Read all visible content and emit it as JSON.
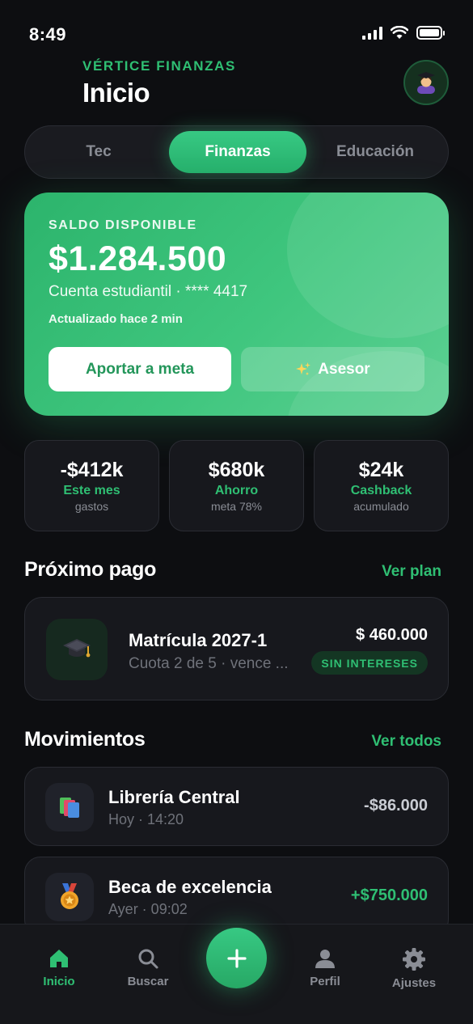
{
  "status_bar": {
    "time": "8:49"
  },
  "header": {
    "brand": "VÉRTICE FINANZAS",
    "title": "Inicio"
  },
  "tabs": [
    {
      "label": "Tec",
      "active": false
    },
    {
      "label": "Finanzas",
      "active": true
    },
    {
      "label": "Educación",
      "active": false
    }
  ],
  "balance": {
    "label": "SALDO DISPONIBLE",
    "amount": "$1.284.500",
    "account": "Cuenta estudiantil · **** 4417",
    "updated": "Actualizado hace 2 min",
    "primary_button": "Aportar a meta",
    "secondary_button": "Asesor"
  },
  "stats": [
    {
      "value": "-$412k",
      "label": "Este mes",
      "sub": "gastos"
    },
    {
      "value": "$680k",
      "label": "Ahorro",
      "sub": "meta 78%"
    },
    {
      "value": "$24k",
      "label": "Cashback",
      "sub": "acumulado"
    }
  ],
  "next_payment": {
    "section_title": "Próximo pago",
    "link": "Ver plan",
    "title": "Matrícula 2027-1",
    "sub": "Cuota 2 de 5 · vence ...",
    "amount": "$ 460.000",
    "badge": "SIN INTERESES",
    "icon": "graduation-cap-icon"
  },
  "movements": {
    "section_title": "Movimientos",
    "link": "Ver todos",
    "items": [
      {
        "title": "Librería Central",
        "sub": "Hoy · 14:20",
        "amount": "-$86.000",
        "icon": "books-icon",
        "amount_color": "#c9ccd3"
      },
      {
        "title": "Beca de excelencia",
        "sub": "Ayer · 09:02",
        "amount": "+$750.000",
        "icon": "medal-icon",
        "amount_color": "#2fbf73"
      }
    ]
  },
  "nav": [
    {
      "label": "Inicio",
      "icon": "home-icon",
      "active": true
    },
    {
      "label": "Buscar",
      "icon": "search-icon",
      "active": false
    },
    {
      "label": "Perfil",
      "icon": "person-icon",
      "active": false
    },
    {
      "label": "Ajustes",
      "icon": "gear-icon",
      "active": false
    }
  ],
  "colors": {
    "accent": "#2fbf73",
    "background": "#0d0e11",
    "card": "#17181d"
  }
}
